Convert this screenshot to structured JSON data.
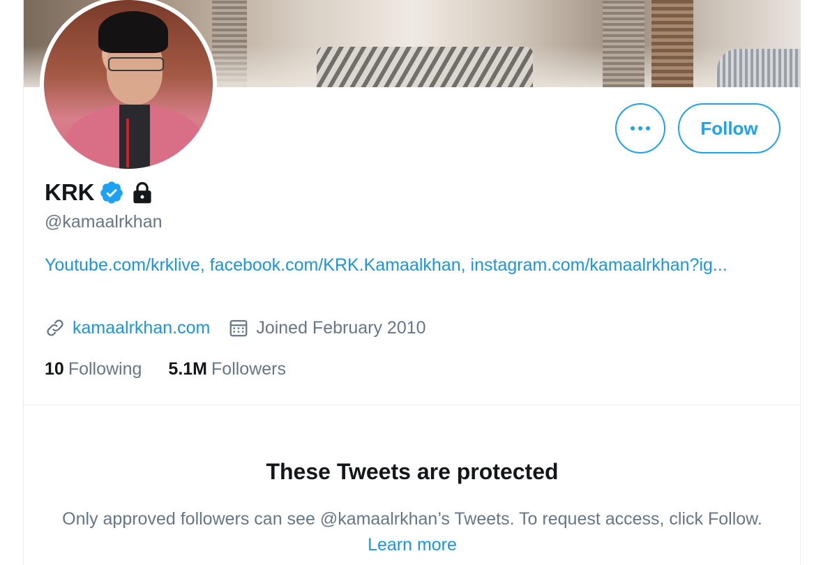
{
  "profile": {
    "display_name": "KRK",
    "handle": "@kamaalrkhan",
    "verified_icon": "verified-badge-icon",
    "lock_icon": "lock-icon",
    "bio": {
      "link1": "Youtube.com/krklive",
      "sep1": ", ",
      "link2": "facebook.com/KRK.Kamaalkhan",
      "sep2": ", ",
      "link3": "instagram.com/kamaalrkhan?ig..."
    },
    "website": "kamaalrkhan.com",
    "joined": "Joined February 2010",
    "website_icon": "link-icon",
    "joined_icon": "calendar-icon"
  },
  "actions": {
    "more_icon": "more-dots-icon",
    "follow_label": "Follow"
  },
  "stats": {
    "following_count": "10",
    "following_label": "Following",
    "followers_count": "5.1M",
    "followers_label": "Followers"
  },
  "protected": {
    "title": "These Tweets are protected",
    "desc_text": "Only approved followers can see @kamaalrkhan’s Tweets. To request access, click Follow.",
    "learn_more": "Learn more"
  },
  "colors": {
    "accent": "#1da1f2",
    "link": "#1b95e0",
    "text_primary": "#14171a",
    "text_secondary": "#657786"
  }
}
